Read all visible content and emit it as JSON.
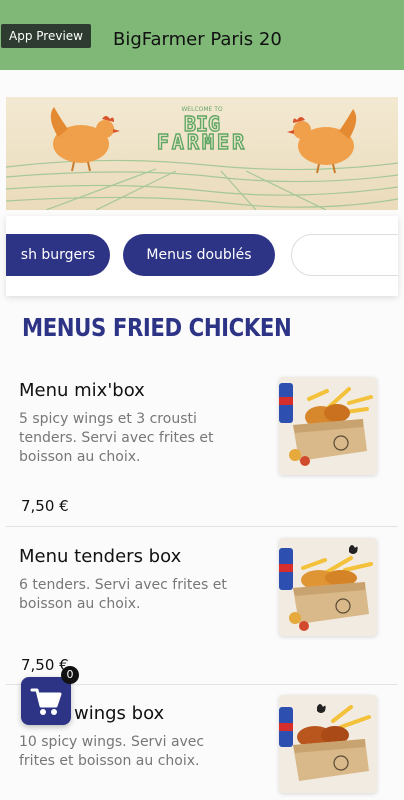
{
  "header": {
    "preview_label": "App Preview",
    "title": "BigFarmer Paris 20"
  },
  "banner": {
    "tagline": "WELCOME TO",
    "brand_line1": "BIG",
    "brand_line2": "FARMER"
  },
  "categories": [
    {
      "label": "Fresh burgers",
      "visible_text": "sh burgers",
      "state": "selected"
    },
    {
      "label": "Menus doublés",
      "state": "selected"
    },
    {
      "label": "",
      "state": "default"
    }
  ],
  "section": {
    "title": "MENUS FRIED CHICKEN"
  },
  "items": [
    {
      "name": "Menu mix'box",
      "description": "5 spicy wings et 3 crousti tenders. Servi avec frites et boisson au choix.",
      "price": "7,50 €",
      "image_icon": "chicken-box-image"
    },
    {
      "name": "Menu tenders box",
      "description": "6 tenders. Servi avec frites et boisson au choix.",
      "price": "7,50 €",
      "image_icon": "chicken-box-image"
    },
    {
      "name": "Menu wings box",
      "description": "10 spicy wings. Servi avec frites et boisson au choix.",
      "price": "",
      "image_icon": "chicken-box-image"
    }
  ],
  "cart": {
    "count": "0",
    "icon": "cart-icon"
  },
  "colors": {
    "header_green": "#7fb877",
    "brand_navy": "#2d3385",
    "banner_beige": "#efe2c6"
  }
}
